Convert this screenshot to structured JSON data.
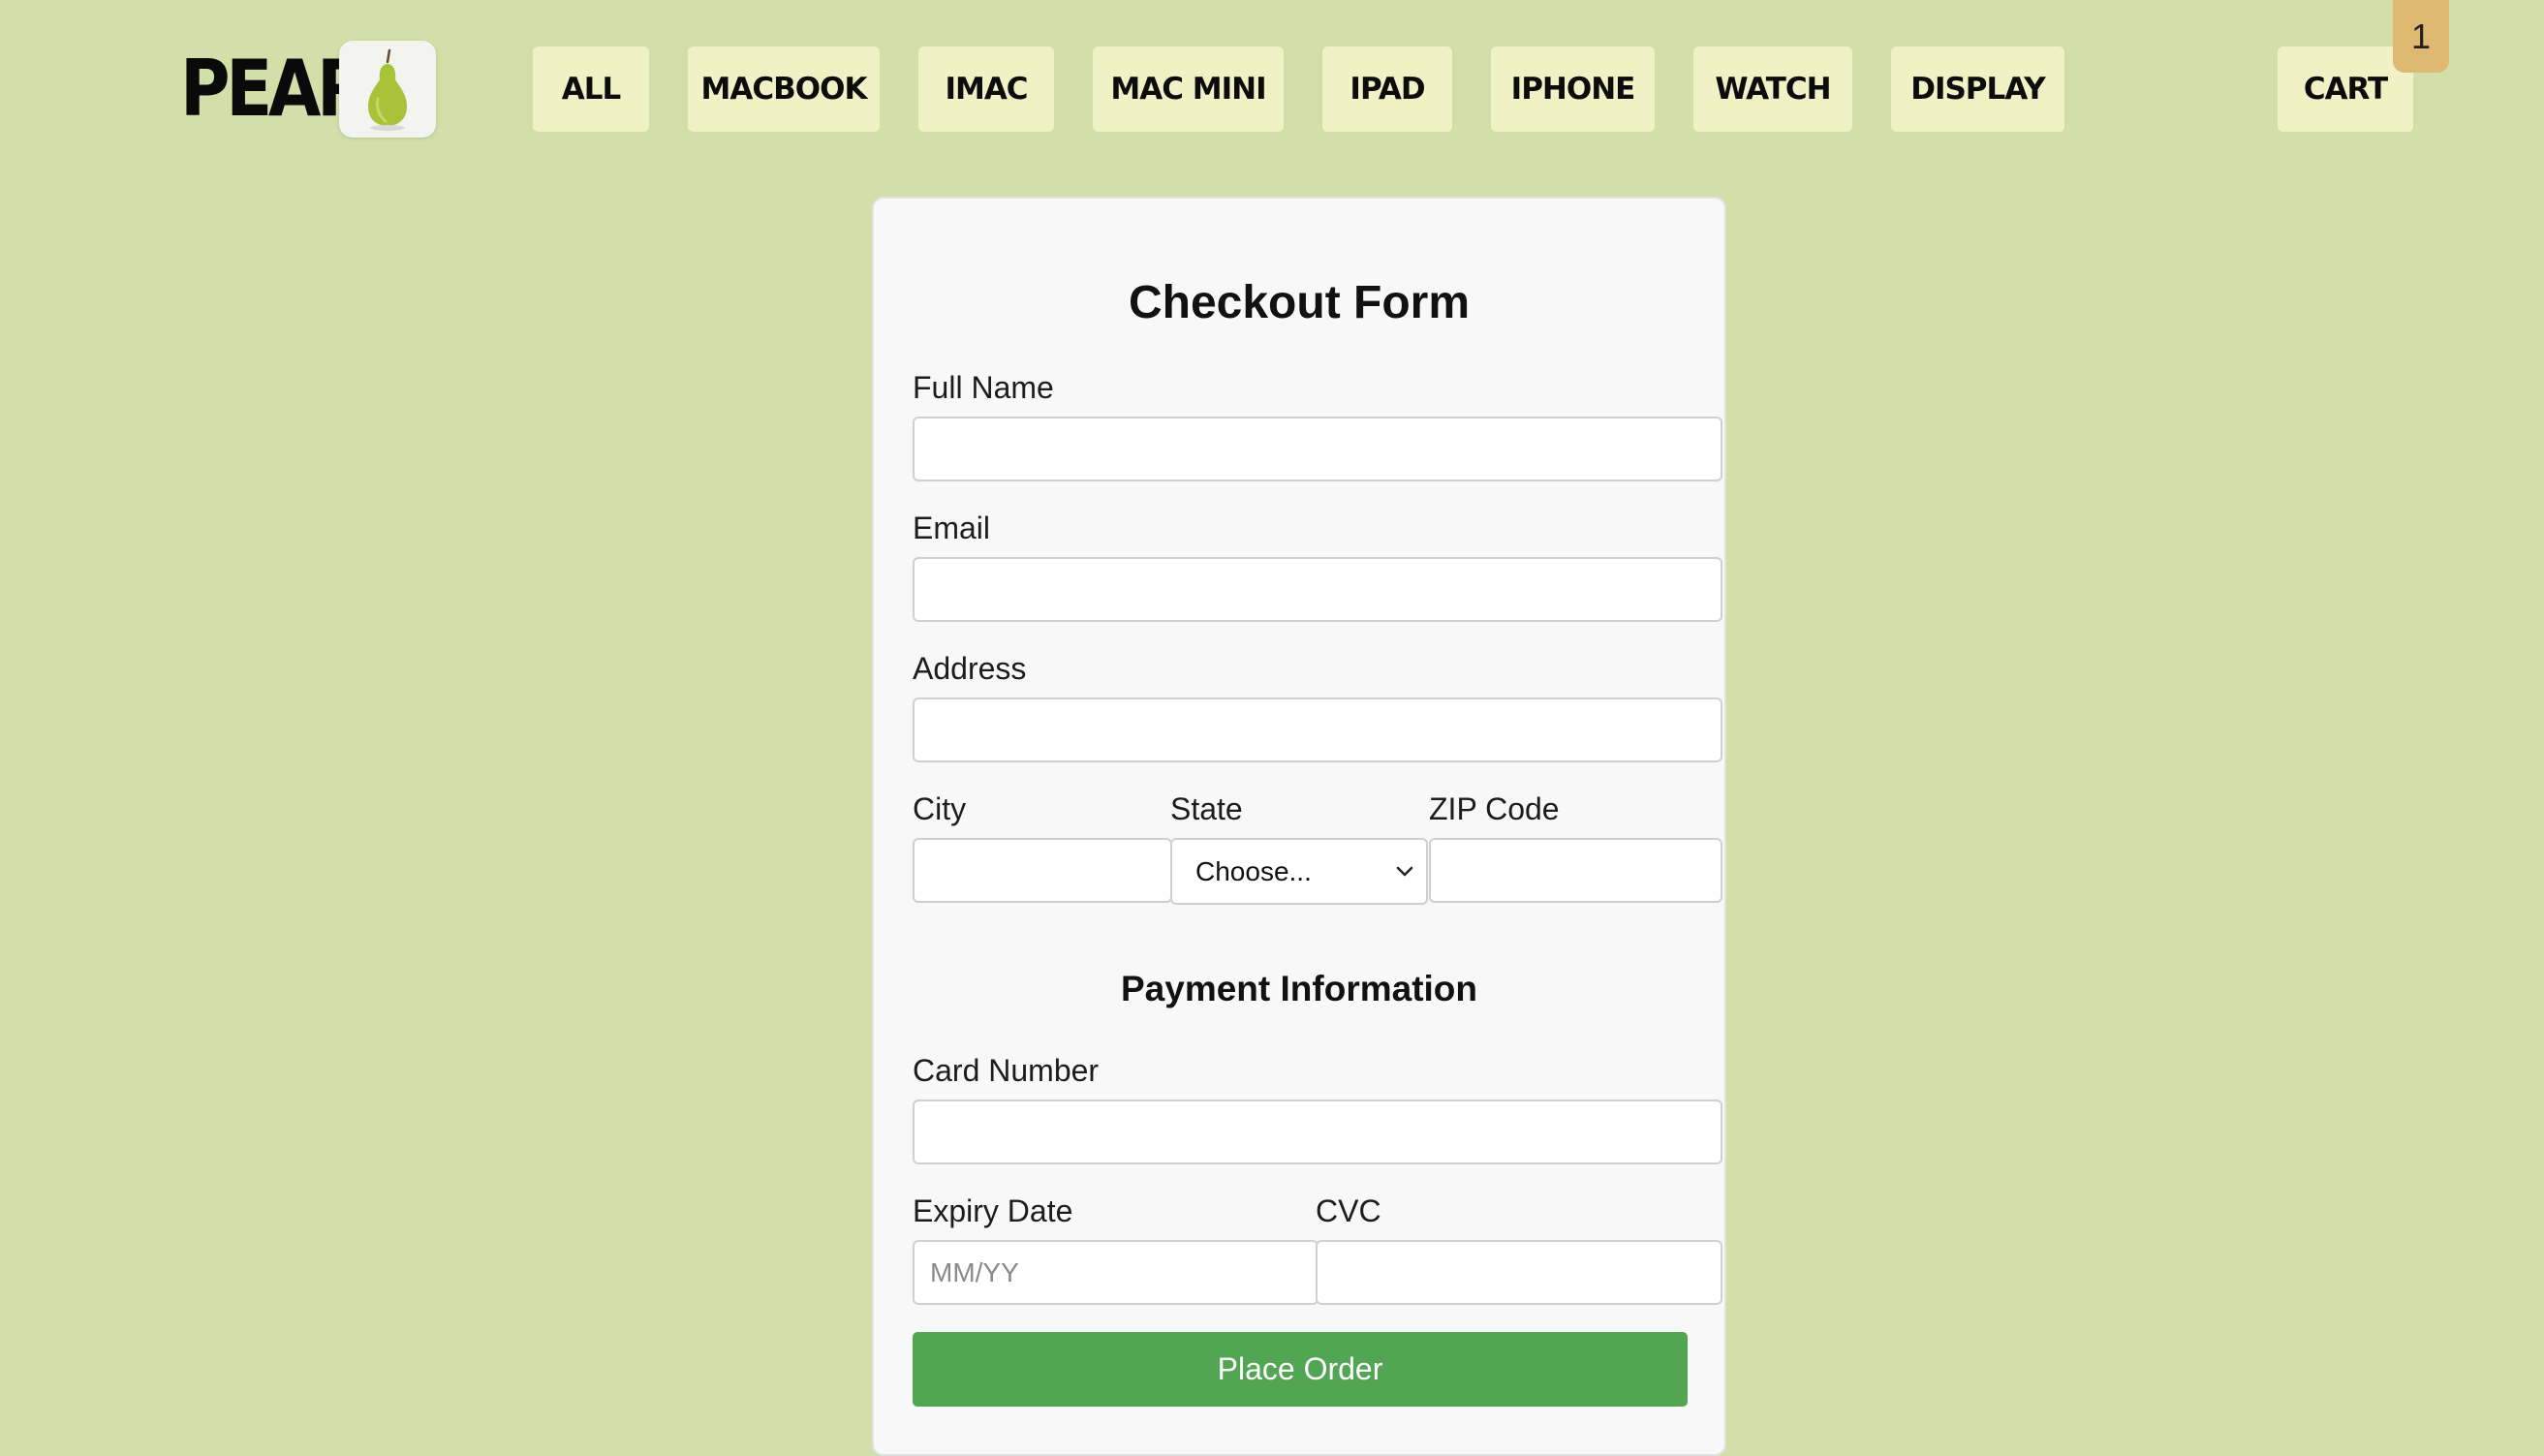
{
  "brand": {
    "name": "PEAR"
  },
  "nav": {
    "items": [
      {
        "label": "ALL"
      },
      {
        "label": "MACBOOK"
      },
      {
        "label": "IMAC"
      },
      {
        "label": "MAC MINI"
      },
      {
        "label": "IPAD"
      },
      {
        "label": "IPHONE"
      },
      {
        "label": "WATCH"
      },
      {
        "label": "DISPLAY"
      }
    ],
    "cart": {
      "label": "CART",
      "count": "1"
    }
  },
  "form": {
    "title": "Checkout Form",
    "full_name": {
      "label": "Full Name",
      "value": ""
    },
    "email": {
      "label": "Email",
      "value": ""
    },
    "address": {
      "label": "Address",
      "value": ""
    },
    "city": {
      "label": "City",
      "value": ""
    },
    "state": {
      "label": "State",
      "selected": "Choose..."
    },
    "zip": {
      "label": "ZIP Code",
      "value": ""
    },
    "payment_title": "Payment Information",
    "card_number": {
      "label": "Card Number",
      "value": ""
    },
    "expiry": {
      "label": "Expiry Date",
      "placeholder": "MM/YY",
      "value": ""
    },
    "cvc": {
      "label": "CVC",
      "value": ""
    },
    "submit_label": "Place Order"
  },
  "colors": {
    "background": "#d2dfa8",
    "nav_button": "#f0f2c6",
    "cart_badge": "#dfb872",
    "submit_button": "#52a653"
  }
}
